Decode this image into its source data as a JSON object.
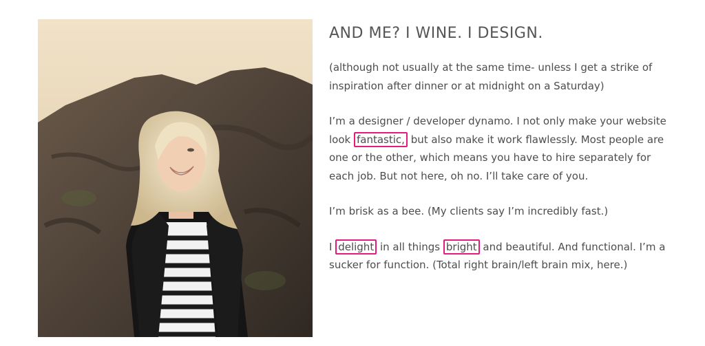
{
  "heading": "AND ME? I WINE. I DESIGN.",
  "photo": {
    "alt": "Portrait photo in front of a rock"
  },
  "paragraphs": [
    {
      "text": "(although not usually at the same time- unless I get a strike of inspiration after dinner or at midnight on a Saturday)"
    },
    {
      "before": "I’m a designer / developer dynamo. I not only make your website look ",
      "highlight1": "fantastic,",
      "after": " but also make it work flawlessly. Most people are one or the other, which means you have to hire separately for each job. But not here, oh no. I’ll take care of you."
    },
    {
      "text": "I’m brisk as a bee. (My clients say I’m incredibly fast.)"
    },
    {
      "before": "I ",
      "highlight1": "delight",
      "middle": " in all things ",
      "highlight2": "bright",
      "after": " and beautiful. And functional. I’m a sucker for function. (Total right brain/left brain mix, here.)"
    }
  ],
  "colors": {
    "highlight_border": "#e6197e",
    "text": "#4d4d4d"
  }
}
